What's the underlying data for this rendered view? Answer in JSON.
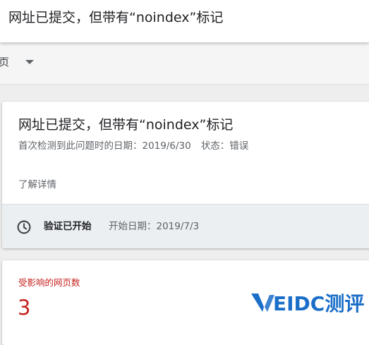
{
  "header": {
    "title": "网址已提交，但带有“noindex”标记"
  },
  "filter_bar": {
    "selected_label": "页"
  },
  "issue_card": {
    "title": "网址已提交，但带有“noindex”标记",
    "first_detected": "首次检测到此问题时的日期：2019/6/30",
    "status": "状态：错误",
    "learn_more": "了解详情",
    "validation": {
      "status_label": "验证已开始",
      "start_date": "开始日期：2019/7/3",
      "icon": "clock-icon"
    }
  },
  "pages_card": {
    "affected_label": "受影响的网页数",
    "affected_count": "3"
  },
  "watermark": {
    "text": "EIDC测评",
    "logo_letter": "V"
  },
  "colors": {
    "error_red": "#c5221f",
    "watermark_blue": "#1b6fc8",
    "text_primary": "#202124",
    "text_secondary": "#5f6368"
  }
}
